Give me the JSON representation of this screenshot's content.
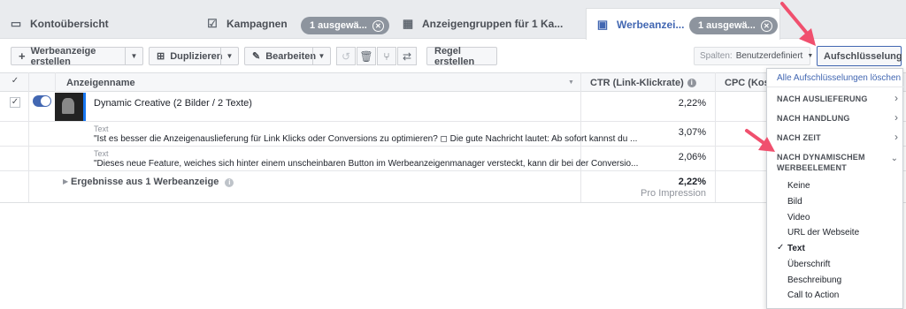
{
  "tabs": [
    {
      "label": "Kontoübersicht",
      "icon": "account-overview-icon"
    },
    {
      "label": "Kampagnen",
      "icon": "campaign-check-icon"
    },
    {
      "label": "Anzeigengruppen für 1 Ka...",
      "icon": "adsets-grid-icon"
    },
    {
      "label": "Werbeanzei...",
      "icon": "ads-icon"
    }
  ],
  "badges": {
    "campaigns": "1 ausgewä...",
    "ads": "1 ausgewä..."
  },
  "toolbar": {
    "create": "Werbeanzeige erstellen",
    "duplicate": "Duplizieren",
    "edit": "Bearbeiten",
    "rule": "Regel erstellen",
    "columns_label": "Spalten:",
    "columns_value": "Benutzerdefiniert",
    "breakdown": "Aufschlüsselung"
  },
  "table": {
    "headers": {
      "name": "Anzeigenname",
      "ctr": "CTR (Link-Klickrate)",
      "cpc": "CPC (Koste"
    },
    "ad_name": "Dynamic Creative (2 Bilder / 2 Texte)",
    "ad_ctr": "2,22%",
    "sub_rows": [
      {
        "label": "Text",
        "text": "\"Ist es besser die Anzeigenauslieferung für Link Klicks oder Conversions zu optimieren? ◻ Die gute Nachricht lautet: Ab sofort kannst du ...",
        "ctr": "3,07%"
      },
      {
        "label": "Text",
        "text": "\"Dieses neue Feature, weiches sich hinter einem unscheinbaren Button im Werbeanzeigenmanager versteckt, kann dir bei der Conversio...",
        "ctr": "2,06%"
      }
    ],
    "results_label": "Ergebnisse aus 1 Werbeanzeige",
    "results_ctr": "2,22%",
    "results_sub": "Pro Impression"
  },
  "dropdown": {
    "clear": "Alle Aufschlüsselungen löschen",
    "sections": [
      "NACH AUSLIEFERUNG",
      "NACH HANDLUNG",
      "NACH ZEIT"
    ],
    "dynamic_line1": "NACH DYNAMISCHEM",
    "dynamic_line2": "WERBEELEMENT",
    "options": [
      "Keine",
      "Bild",
      "Video",
      "URL der Webseite",
      "Text",
      "Überschrift",
      "Beschreibung",
      "Call to Action"
    ],
    "selected": "Text"
  },
  "colors": {
    "accent": "#4267b2",
    "arrow": "#f0506e"
  }
}
